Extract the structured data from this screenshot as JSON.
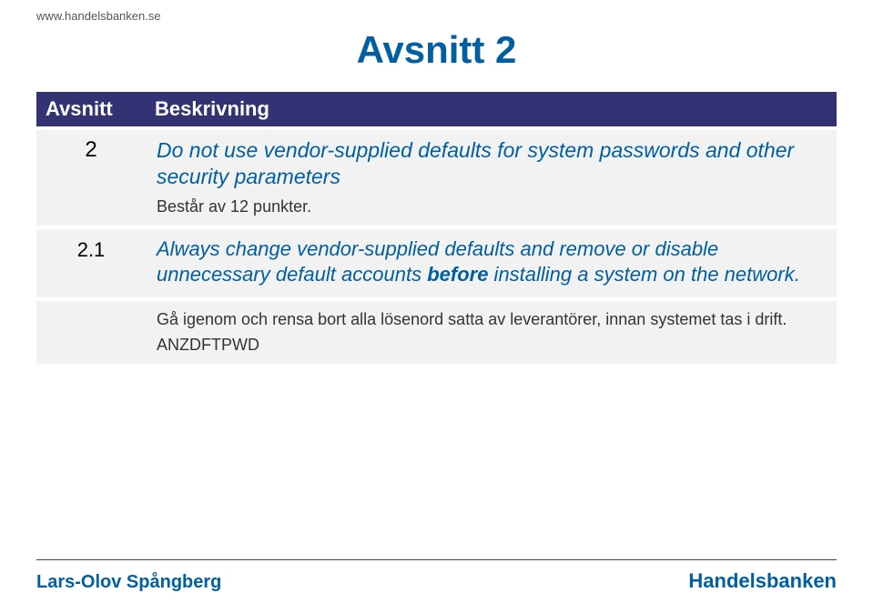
{
  "header": {
    "url": "www.handelsbanken.se"
  },
  "title": "Avsnitt 2",
  "table": {
    "headers": {
      "col1": "Avsnitt",
      "col2": "Beskrivning"
    },
    "rows": [
      {
        "num": "2",
        "main": "Do not use vendor-supplied defaults for system passwords and other security parameters",
        "note": "Består av 12 punkter."
      },
      {
        "num": "2.1",
        "sub_pre": "Always change vendor-supplied defaults and remove or disable unnecessary default accounts ",
        "sub_bold": "before",
        "sub_post": " installing a system on the network."
      },
      {
        "num": "",
        "extra": "Gå igenom och rensa bort alla lösenord satta av leverantörer, innan systemet tas i drift.",
        "cmd": "ANZDFTPWD"
      }
    ]
  },
  "footer": {
    "author": "Lars-Olov Spångberg",
    "brand": "Handelsbanken"
  }
}
